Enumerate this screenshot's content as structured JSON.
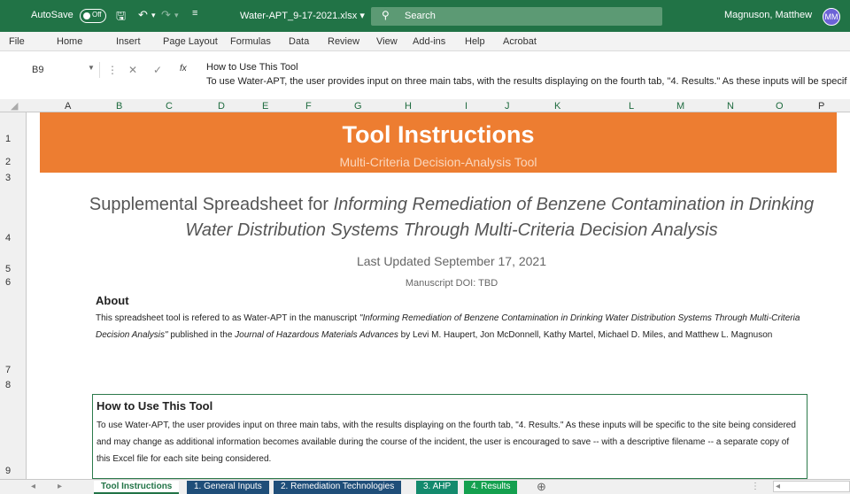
{
  "titlebar": {
    "autosave_label": "AutoSave",
    "autosave_state": "Off",
    "filename": "Water-APT_9-17-2021.xlsx",
    "filename_dropdown": "▾",
    "search_label": "Search",
    "user_name": "Magnuson, Matthew",
    "user_initials": "MM"
  },
  "menu": [
    "File",
    "Home",
    "Insert",
    "Page Layout",
    "Formulas",
    "Data",
    "Review",
    "View",
    "Add-ins",
    "Help",
    "Acrobat"
  ],
  "formula_bar": {
    "name_box": "B9",
    "fx": "fx",
    "line1": "How to Use This Tool",
    "line2": "To use Water-APT, the user provides input on three main tabs, with the results displaying on the fourth tab, \"4. Results.\" As these inputs will be specif"
  },
  "columns": [
    "A",
    "B",
    "C",
    "D",
    "E",
    "F",
    "G",
    "H",
    "I",
    "J",
    "K",
    "L",
    "M",
    "N",
    "O",
    "P"
  ],
  "rows": [
    "1",
    "2",
    "3",
    "4",
    "5",
    "6",
    "7",
    "8",
    "9"
  ],
  "banner": {
    "title": "Tool Instructions",
    "subtitle": "Multi-Criteria Decision-Analysis Tool"
  },
  "supplemental": {
    "prefix": "Supplemental Spreadsheet for ",
    "title_part1": "Informing Remediation of Benzene Contamination in Drinking",
    "title_part2": "Water Distribution Systems Through Multi-Criteria Decision Analysis"
  },
  "last_updated": "Last Updated September 17, 2021",
  "doi": "Manuscript DOI: TBD",
  "about": {
    "heading": "About",
    "text_a": "This spreadsheet tool is refered to as Water-APT in the manuscript ",
    "text_italic": "\"Informing Remediation of Benzene Contamination in Drinking Water Distribution Systems Through Multi-Criteria Decision Analysis\"",
    "text_b": " published in the ",
    "journal": "Journal of Hazardous Materials Advances",
    "text_c": " by Levi M. Haupert, Jon McDonnell, Kathy Martel, Michael D. Miles, and Matthew L. Magnuson"
  },
  "howto": {
    "heading": "How to Use This Tool",
    "text": "To use Water-APT, the user provides input on three main tabs, with the results displaying on the fourth tab, \"4. Results.\" As these inputs will be specific to the site being considered and may change as additional information becomes available during the course of the incident, the user is encouraged to save -- with a descriptive filename -- a separate copy of this Excel file for each site being considered."
  },
  "sheet_tabs": [
    "Tool Instructions",
    "1. General Inputs",
    "2. Remediation Technologies",
    "3. AHP",
    "4. Results"
  ],
  "add_sheet": "⊕",
  "colors": {
    "excel_green": "#217346",
    "banner_orange": "#ed7d31",
    "tab_blue": "#1f4e79",
    "tab_teal": "#138a6d",
    "tab_green": "#14a04f"
  }
}
